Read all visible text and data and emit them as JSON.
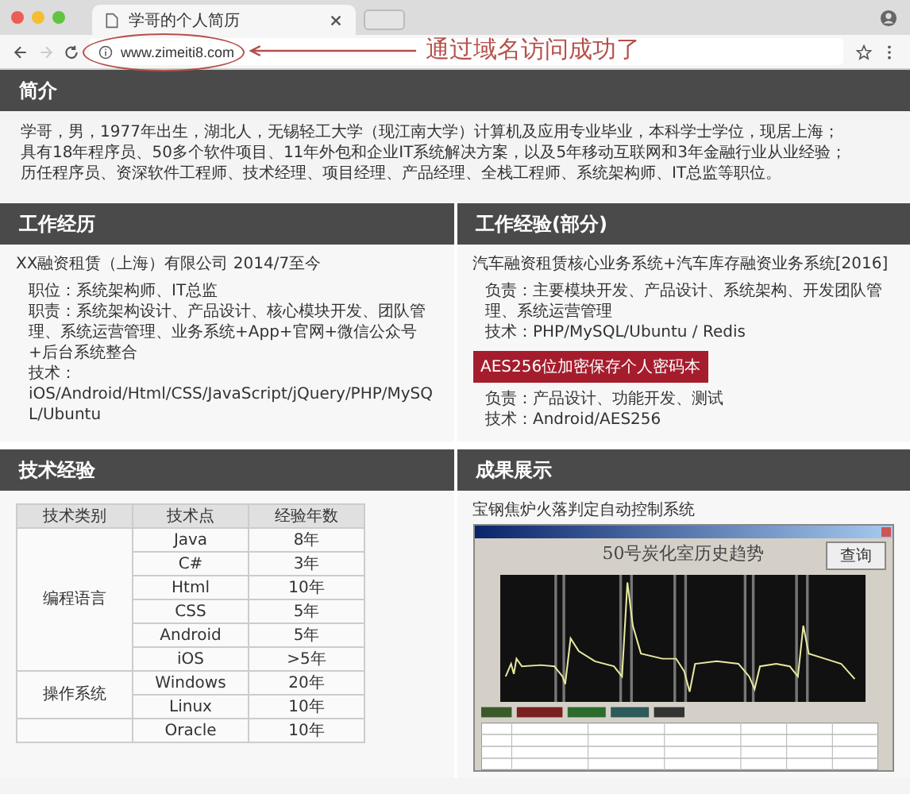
{
  "browser": {
    "tab_title": "学哥的个人简历",
    "url": "www.zimeiti8.com",
    "forward_disabled": true,
    "annotation": "通过域名访问成功了"
  },
  "intro": {
    "title": "简介",
    "lines": [
      "学哥，男，1977年出生，湖北人，无锡轻工大学（现江南大学）计算机及应用专业毕业，本科学士学位，现居上海；",
      "具有18年程序员、50多个软件项目、11年外包和企业IT系统解决方案，以及5年移动互联网和3年金融行业从业经验；",
      "历任程序员、资深软件工程师、技术经理、项目经理、产品经理、全栈工程师、系统架构师、IT总监等职位。"
    ]
  },
  "work_history": {
    "title": "工作经历",
    "company": "XX融资租赁（上海）有限公司 2014/7至今",
    "details": [
      "职位：系统架构师、IT总监",
      "职责：系统架构设计、产品设计、核心模块开发、团队管理、系统运营管理、业务系统+App+官网+微信公众号+后台系统整合",
      "技术：",
      "iOS/Android/Html/CSS/JavaScript/jQuery/PHP/MySQL/Ubuntu"
    ]
  },
  "work_experience": {
    "title": "工作经验(部分)",
    "projects": [
      {
        "kind": "text",
        "name": "汽车融资租赁核心业务系统+汽车库存融资业务系统[2016]",
        "details": [
          "负责：主要模块开发、产品设计、系统架构、开发团队管理、系统运营管理",
          "技术：PHP/MySQL/Ubuntu / Redis"
        ]
      },
      {
        "kind": "badge",
        "name": "AES256位加密保存个人密码本",
        "details": [
          "负责：产品设计、功能开发、测试",
          "技术：Android/AES256"
        ]
      }
    ]
  },
  "tech_experience": {
    "title": "技术经验",
    "columns": [
      "技术类别",
      "技术点",
      "经验年数"
    ],
    "groups": [
      {
        "category": "编程语言",
        "items": [
          {
            "tech": "Java",
            "years": "8年"
          },
          {
            "tech": "C#",
            "years": "3年"
          },
          {
            "tech": "Html",
            "years": "10年"
          },
          {
            "tech": "CSS",
            "years": "5年"
          },
          {
            "tech": "Android",
            "years": "5年"
          },
          {
            "tech": "iOS",
            "years": ">5年"
          }
        ]
      },
      {
        "category": "操作系统",
        "items": [
          {
            "tech": "Windows",
            "years": "20年"
          },
          {
            "tech": "Linux",
            "years": "10年"
          }
        ]
      },
      {
        "items": [
          {
            "tech": "Oracle",
            "years": "10年"
          }
        ]
      }
    ]
  },
  "showcase": {
    "title": "成果展示",
    "caption": "宝钢焦炉火落判定自动控制系统",
    "window": {
      "heading": "50号炭化室历史趋势",
      "button": "查询"
    }
  }
}
